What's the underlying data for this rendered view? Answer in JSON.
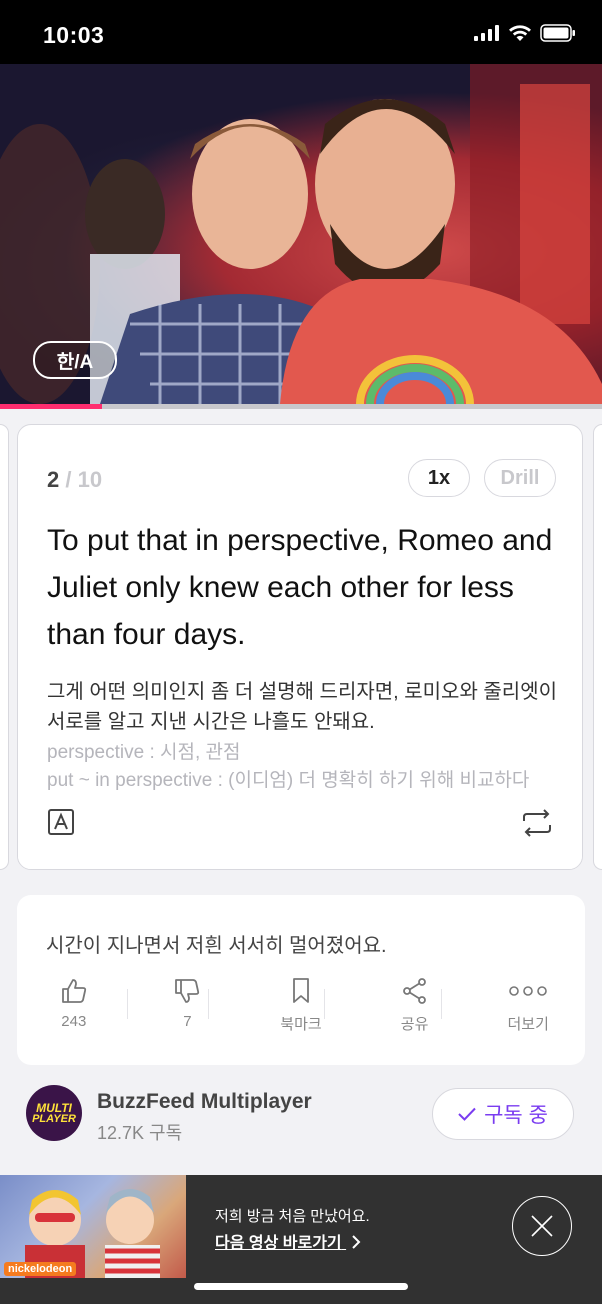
{
  "status": {
    "time": "10:03"
  },
  "video": {
    "lang_toggle": "한/A",
    "progress": 0.17
  },
  "card": {
    "current": "2",
    "total": "/ 10",
    "speed": "1x",
    "drill": "Drill",
    "sentence": "To put that in perspective, Romeo and Juliet only knew each other for less than four days.",
    "translation": "그게 어떤 의미인지 좀 더 설명해 드리자면, 로미오와 줄리엣이 서로를 알고 지낸 시간은 나흘도 안돼요.",
    "vocab": [
      "perspective : 시점, 관점",
      "put ~ in perspective : (이디엄) 더 명확히 하기 위해 비교하다"
    ]
  },
  "info": {
    "caption": "시간이 지나면서 저흰 서서히 멀어졌어요.",
    "actions": [
      {
        "icon": "thumbs-up-icon",
        "label": "243"
      },
      {
        "icon": "thumbs-down-icon",
        "label": "7"
      },
      {
        "icon": "bookmark-icon",
        "label": "북마크"
      },
      {
        "icon": "share-icon",
        "label": "공유"
      },
      {
        "icon": "more-icon",
        "label": "더보기"
      }
    ]
  },
  "channel": {
    "avatar_line1": "MULTI",
    "avatar_line2": "PLAYER",
    "name": "BuzzFeed Multiplayer",
    "subscribers": "12.7K 구독",
    "subscribe_label": "구독 중"
  },
  "ad": {
    "brand": "nickelodeon",
    "line1": "저희 방금 처음 만났어요.",
    "line2": "다음 영상 바로가기"
  },
  "colors": {
    "accent": "#7a3cf0",
    "progress": "#ff2d6f"
  }
}
